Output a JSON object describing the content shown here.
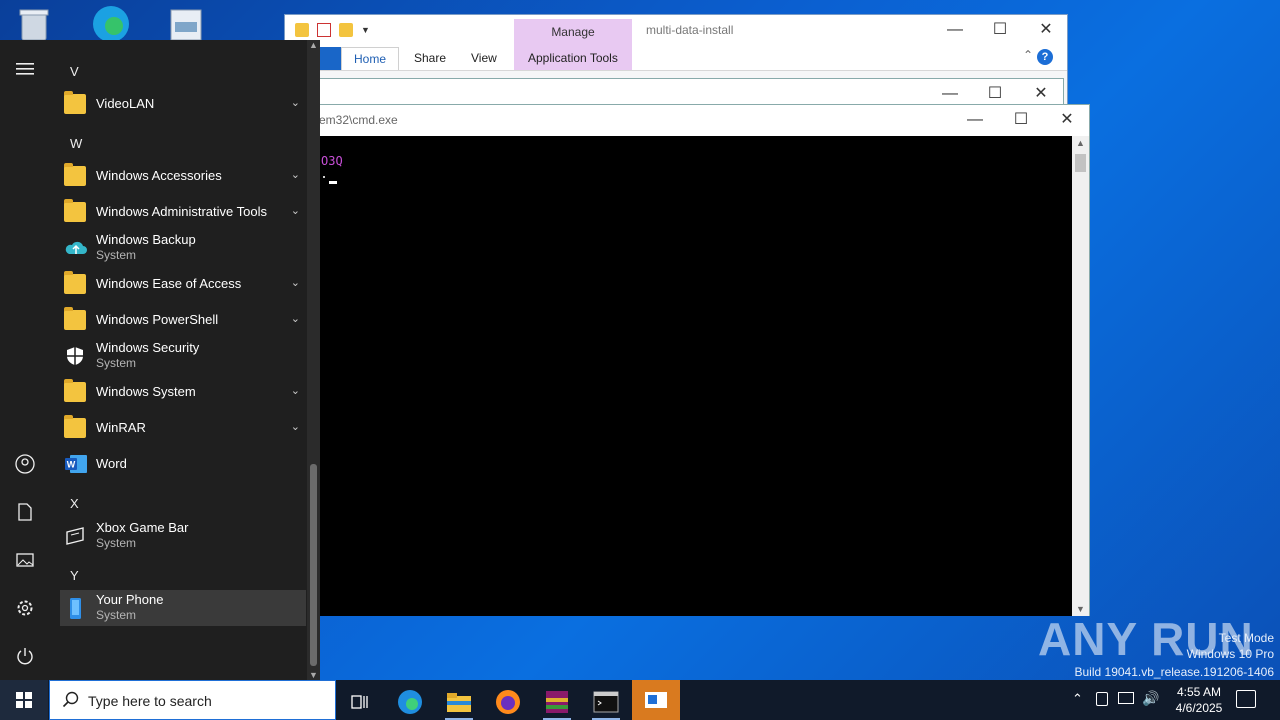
{
  "explorer": {
    "title": "multi-data-install",
    "manage_label": "Manage",
    "tabs": [
      "Home",
      "Share",
      "View",
      "Application Tools"
    ]
  },
  "cmd": {
    "title": "em32\\cmd.exe",
    "output_line": "O3Q"
  },
  "start_menu": {
    "letters": {
      "v": "V",
      "w": "W",
      "x": "X",
      "y": "Y"
    },
    "apps": [
      {
        "name": "VideoLAN",
        "sub": ""
      },
      {
        "name": "Windows Accessories",
        "sub": ""
      },
      {
        "name": "Windows Administrative Tools",
        "sub": ""
      },
      {
        "name": "Windows Backup",
        "sub": "System"
      },
      {
        "name": "Windows Ease of Access",
        "sub": ""
      },
      {
        "name": "Windows PowerShell",
        "sub": ""
      },
      {
        "name": "Windows Security",
        "sub": "System"
      },
      {
        "name": "Windows System",
        "sub": ""
      },
      {
        "name": "WinRAR",
        "sub": ""
      },
      {
        "name": "Word",
        "sub": ""
      },
      {
        "name": "Xbox Game Bar",
        "sub": "System"
      },
      {
        "name": "Your Phone",
        "sub": "System"
      }
    ]
  },
  "taskbar": {
    "search_placeholder": "Type here to search",
    "time": "4:55 AM",
    "date": "4/6/2025"
  },
  "watermark": {
    "brand": "ANY RUN",
    "line1": "Test Mode",
    "line2": "Windows 10 Pro",
    "line3": "Build 19041.vb_release.191206-1406"
  }
}
